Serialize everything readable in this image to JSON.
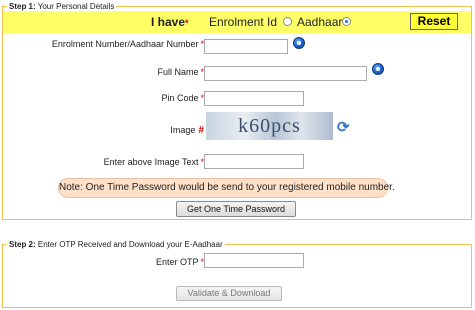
{
  "step1": {
    "legend_step": "Step 1:",
    "legend_text": " Your Personal Details",
    "header": {
      "i_have": "I have",
      "required_mark": "*",
      "option_enrolment": "Enrolment Id",
      "option_aadhaar": "Aadhaar",
      "selected_option": "Aadhaar",
      "reset_label": "Reset"
    },
    "fields": {
      "enrolment_number": {
        "label": "Enrolment Number/Aadhaar Number",
        "required_mark": "*",
        "value": ""
      },
      "full_name": {
        "label": "Full Name",
        "required_mark": "*",
        "value": ""
      },
      "pin_code": {
        "label": "Pin Code",
        "required_mark": "*",
        "value": ""
      },
      "image": {
        "label": "Image",
        "required_mark": "#",
        "captcha_text": "k60pcs"
      },
      "image_text": {
        "label": "Enter above Image Text",
        "required_mark": "*",
        "value": ""
      }
    },
    "note": "Note: One Time Password would be send to your registered mobile number.",
    "otp_button": "Get One Time Password"
  },
  "step2": {
    "legend_step": "Step 2:",
    "legend_text": " Enter OTP Received and Download your E-Aadhaar",
    "otp": {
      "label": "Enter OTP",
      "required_mark": "*",
      "value": ""
    },
    "validate_button": "Validate & Download"
  },
  "icons": {
    "help": "help-globe-icon",
    "refresh": "refresh-icon"
  },
  "colors": {
    "border": "#f0c050",
    "header_bar": "#ffff66",
    "reset_button": "#ffff33",
    "required": "#d40000",
    "note_bg": "#ffe0c8"
  }
}
